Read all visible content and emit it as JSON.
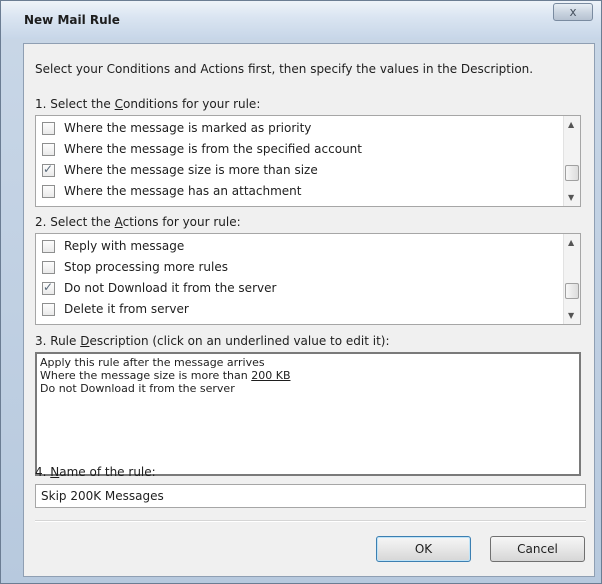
{
  "window": {
    "title": "New Mail Rule",
    "close_glyph": "x"
  },
  "intro": "Select your Conditions and Actions first, then specify the values in the Description.",
  "conditions": {
    "label_pre": "1. Select the ",
    "label_key": "C",
    "label_post": "onditions for your rule:",
    "items": [
      {
        "label": "Where the message is marked as priority",
        "checked": false
      },
      {
        "label": "Where the message is from the specified account",
        "checked": false
      },
      {
        "label": "Where the message size is more than size",
        "checked": true
      },
      {
        "label": "Where the message has an attachment",
        "checked": false
      }
    ],
    "scroll_position": 0.75
  },
  "actions": {
    "label_pre": "2. Select the ",
    "label_key": "A",
    "label_post": "ctions for your rule:",
    "items": [
      {
        "label": "Reply with message",
        "checked": false
      },
      {
        "label": "Stop processing more rules",
        "checked": false
      },
      {
        "label": "Do not Download it from the server",
        "checked": true
      },
      {
        "label": "Delete it from server",
        "checked": false
      }
    ],
    "scroll_position": 0.75
  },
  "description": {
    "label_pre": "3. Rule ",
    "label_key": "D",
    "label_post": "escription (click on an underlined value to edit it):",
    "line1": "Apply this rule after the message arrives",
    "line2_pre": "Where the message size is more than ",
    "line2_link": "200 KB",
    "line3": "Do not Download it from the server"
  },
  "name": {
    "label_pre": "4. ",
    "label_key": "N",
    "label_post": "ame of the rule:",
    "value": "Skip 200K Messages"
  },
  "buttons": {
    "ok": "OK",
    "cancel": "Cancel"
  },
  "icons": {
    "check": "checkmark-icon",
    "scroll_up": "scroll-up-arrow-icon",
    "scroll_down": "scroll-down-arrow-icon",
    "close": "close-icon"
  }
}
